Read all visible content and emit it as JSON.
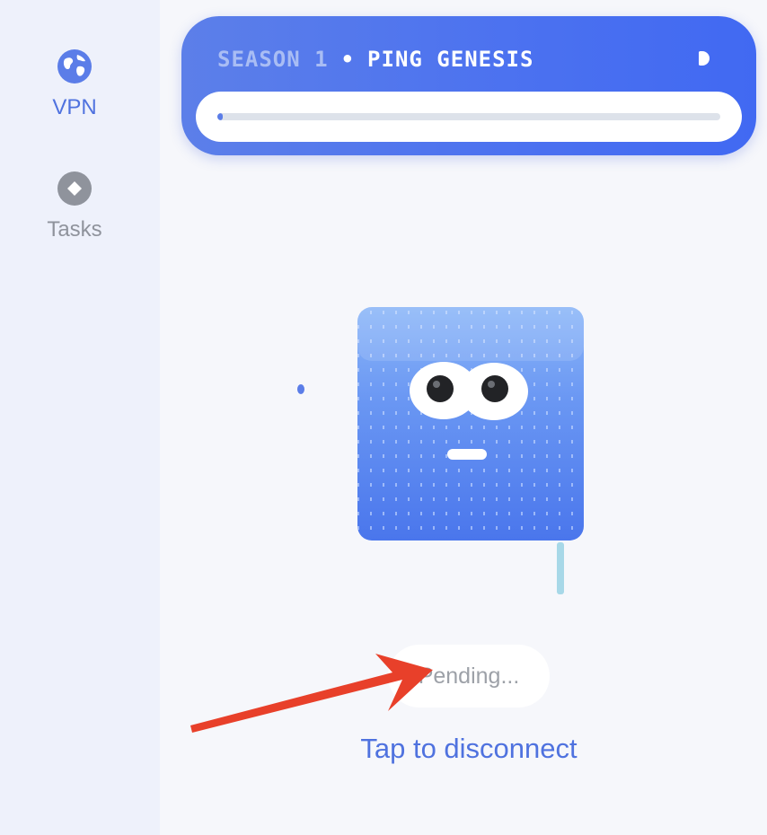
{
  "sidebar": {
    "items": [
      {
        "label": "VPN",
        "icon": "globe-icon",
        "active": true
      },
      {
        "label": "Tasks",
        "icon": "diamond-icon",
        "active": false
      }
    ]
  },
  "banner": {
    "season": "SEASON 1",
    "separator": "•",
    "campaign": "PING GENESIS",
    "progress_percent": 1
  },
  "mascot": {
    "icon": "cube-mascot-icon"
  },
  "status": {
    "text": "Pending..."
  },
  "action": {
    "label": "Tap to disconnect"
  },
  "colors": {
    "accent": "#4f72df",
    "banner_start": "#5c7fe9",
    "banner_end": "#4169f2",
    "annotation_arrow": "#e8402a"
  }
}
